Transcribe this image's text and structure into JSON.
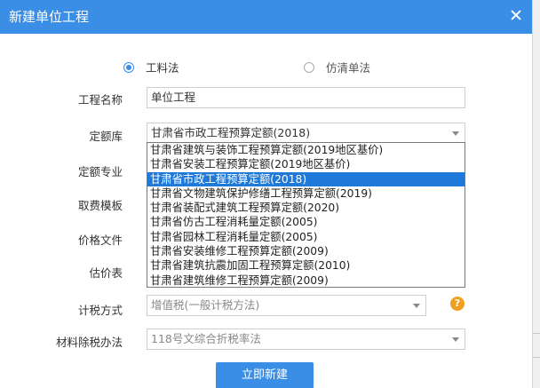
{
  "dialog": {
    "title": "新建单位工程"
  },
  "mode": {
    "option1": "工料法",
    "option2": "仿清单法",
    "selected": "option1"
  },
  "fields": {
    "project_name_label": "工程名称",
    "project_name_value": "单位工程",
    "quota_lib_label": "定额库",
    "quota_lib_value": "甘肃省市政工程预算定额(2018)",
    "quota_major_label": "定额专业",
    "fee_template_label": "取费模板",
    "price_file_label": "价格文件",
    "valuation_table_label": "估价表",
    "tax_method_label": "计税方式",
    "tax_method_value": "增值税(一般计税方法)",
    "material_tax_label": "材料除税办法",
    "material_tax_value": "118号文综合折税率法"
  },
  "quota_options": [
    "甘肃省建筑与装饰工程预算定额(2019地区基价)",
    "甘肃省安装工程预算定额(2019地区基价)",
    "甘肃省市政工程预算定额(2018)",
    "甘肃省文物建筑保护修缮工程预算定额(2019)",
    "甘肃省装配式建筑工程预算定额(2020)",
    "甘肃省仿古工程消耗量定额(2005)",
    "甘肃省园林工程消耗量定额(2005)",
    "甘肃省安装维修工程预算定额(2009)",
    "甘肃省建筑抗震加固工程预算定额(2010)",
    "甘肃省建筑维修工程预算定额(2009)"
  ],
  "quota_selected_index": 2,
  "help_glyph": "?",
  "submit_label": "立即新建",
  "colors": {
    "primary": "#3a8ee6",
    "selected_option": "#1e79d8",
    "help": "#f0a020"
  }
}
